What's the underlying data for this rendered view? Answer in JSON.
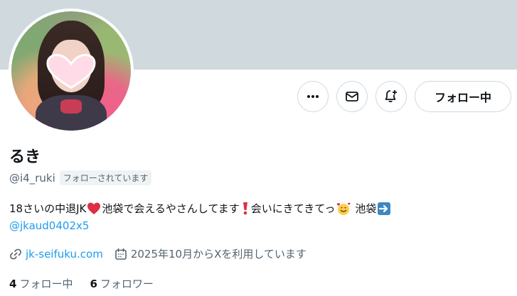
{
  "profile": {
    "display_name": "るき",
    "handle": "@i4_ruki",
    "follows_you_badge": "フォローされています",
    "follow_button_label": "フォロー中"
  },
  "bio": {
    "line1_part1": "18さいの中退JK",
    "line1_part2": "池袋で会えるやさんしてます",
    "line1_part3": "会いにきてきてっ",
    "line1_part4": "池袋",
    "mention": "@jkaud0402x5"
  },
  "meta": {
    "website": "jk-seifuku.com",
    "joined": "2025年10月からXを利用しています"
  },
  "counts": {
    "following_number": "4",
    "following_label": "フォロー中",
    "followers_number": "6",
    "followers_label": "フォロワー"
  },
  "icons": [
    "more-icon",
    "message-icon",
    "notification-bell-icon",
    "link-icon",
    "calendar-icon",
    "heart-emoji-icon",
    "exclamation-emoji-icon",
    "smiling-hearts-emoji-icon",
    "right-arrow-emoji-icon"
  ],
  "colors": {
    "accent": "#1d9bf0",
    "banner": "#cfd9de",
    "secondary_text": "#536471"
  }
}
